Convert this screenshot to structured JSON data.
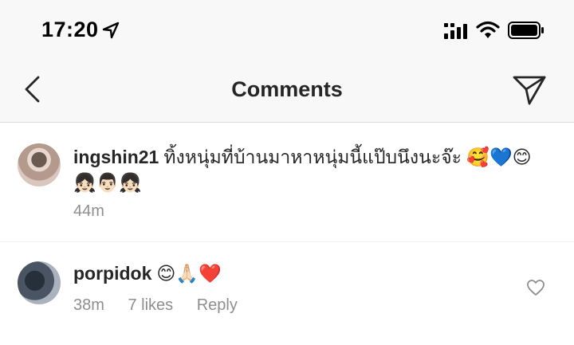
{
  "status_bar": {
    "time": "17:20",
    "icons": [
      "location-arrow-icon",
      "cellular-signal-icon",
      "wifi-icon",
      "battery-icon"
    ]
  },
  "header": {
    "title": "Comments",
    "back_icon": "chevron-left-icon",
    "send_icon": "paper-plane-icon"
  },
  "comments": [
    {
      "username": "ingshin21",
      "text": "ทิ้งหนุ่มที่บ้านมาหาหนุ่มนี้แป๊บนึงนะจ๊ะ 🥰💙😊\n👧🏻👨🏻👧🏻",
      "time": "44m"
    },
    {
      "username": "porpidok",
      "text": "😊🙏🏻❤️",
      "time": "38m",
      "likes": "7 likes",
      "reply_label": "Reply"
    }
  ],
  "colors": {
    "header_bg": "#f8f8f8",
    "text": "#262626",
    "muted": "#8e8e8e"
  }
}
